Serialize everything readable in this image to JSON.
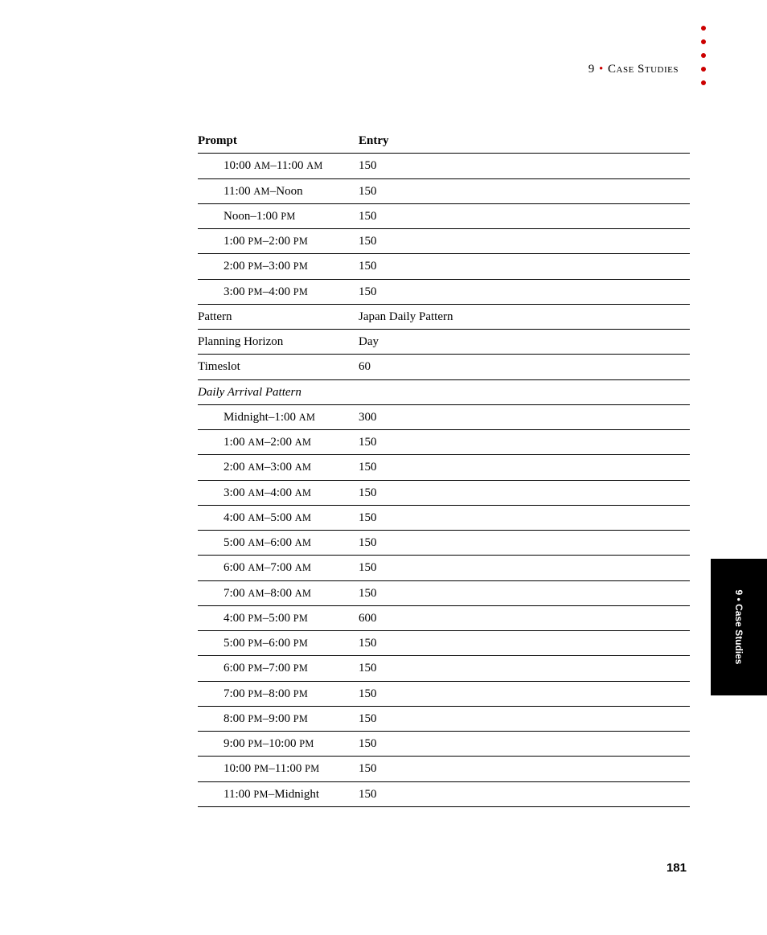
{
  "header": {
    "chapter_number": "9",
    "separator": "•",
    "chapter_title": "Case Studies"
  },
  "side_tab": "9 • Case Studies",
  "page_number": "181",
  "table": {
    "col1_header": "Prompt",
    "col2_header": "Entry",
    "rows": [
      {
        "type": "indent-time",
        "prefix": "10:00",
        "ampm1": "am",
        "dash": "–",
        "suffix": "11:00",
        "ampm2": "am",
        "entry": "150"
      },
      {
        "type": "indent-time",
        "prefix": "11:00",
        "ampm1": "am",
        "dash": "–",
        "suffix": "Noon",
        "ampm2": "",
        "entry": "150"
      },
      {
        "type": "indent-time",
        "prefix": "Noon",
        "ampm1": "",
        "dash": "–",
        "suffix": "1:00",
        "ampm2": "pm",
        "entry": "150"
      },
      {
        "type": "indent-time",
        "prefix": "1:00",
        "ampm1": "pm",
        "dash": "–",
        "suffix": "2:00",
        "ampm2": "pm",
        "entry": "150"
      },
      {
        "type": "indent-time",
        "prefix": "2:00",
        "ampm1": "pm",
        "dash": "–",
        "suffix": "3:00",
        "ampm2": "pm",
        "entry": "150"
      },
      {
        "type": "indent-time",
        "prefix": "3:00",
        "ampm1": "pm",
        "dash": "–",
        "suffix": "4:00",
        "ampm2": "pm",
        "entry": "150"
      },
      {
        "type": "plain",
        "prompt": "Pattern",
        "entry": "Japan Daily Pattern"
      },
      {
        "type": "plain",
        "prompt": "Planning Horizon",
        "entry": "Day"
      },
      {
        "type": "plain",
        "prompt": "Timeslot",
        "entry": "60"
      },
      {
        "type": "section",
        "prompt": "Daily Arrival Pattern",
        "entry": ""
      },
      {
        "type": "indent-time",
        "prefix": "Midnight",
        "ampm1": "",
        "dash": "–",
        "suffix": "1:00",
        "ampm2": "am",
        "entry": "300"
      },
      {
        "type": "indent-time",
        "prefix": "1:00",
        "ampm1": "am",
        "dash": "–",
        "suffix": "2:00",
        "ampm2": "am",
        "entry": "150"
      },
      {
        "type": "indent-time",
        "prefix": "2:00",
        "ampm1": "am",
        "dash": "–",
        "suffix": "3:00",
        "ampm2": "am",
        "entry": "150"
      },
      {
        "type": "indent-time",
        "prefix": "3:00",
        "ampm1": "am",
        "dash": "–",
        "suffix": "4:00",
        "ampm2": "am",
        "entry": "150"
      },
      {
        "type": "indent-time",
        "prefix": "4:00",
        "ampm1": "am",
        "dash": "–",
        "suffix": "5:00",
        "ampm2": "am",
        "entry": "150"
      },
      {
        "type": "indent-time",
        "prefix": "5:00",
        "ampm1": "am",
        "dash": "–",
        "suffix": "6:00",
        "ampm2": "am",
        "entry": "150"
      },
      {
        "type": "indent-time",
        "prefix": "6:00",
        "ampm1": "am",
        "dash": "–",
        "suffix": "7:00",
        "ampm2": "am",
        "entry": "150"
      },
      {
        "type": "indent-time",
        "prefix": "7:00",
        "ampm1": "am",
        "dash": "–",
        "suffix": "8:00",
        "ampm2": "am",
        "entry": "150"
      },
      {
        "type": "indent-time",
        "prefix": "4:00",
        "ampm1": "pm",
        "dash": "–",
        "suffix": "5:00",
        "ampm2": "pm",
        "entry": "600"
      },
      {
        "type": "indent-time",
        "prefix": "5:00",
        "ampm1": "pm",
        "dash": "–",
        "suffix": "6:00",
        "ampm2": "pm",
        "entry": "150"
      },
      {
        "type": "indent-time",
        "prefix": "6:00",
        "ampm1": "pm",
        "dash": "–",
        "suffix": "7:00",
        "ampm2": "pm",
        "entry": "150"
      },
      {
        "type": "indent-time",
        "prefix": "7:00",
        "ampm1": "pm",
        "dash": "–",
        "suffix": "8:00",
        "ampm2": "pm",
        "entry": "150"
      },
      {
        "type": "indent-time",
        "prefix": "8:00",
        "ampm1": "pm",
        "dash": "–",
        "suffix": "9:00",
        "ampm2": "pm",
        "entry": "150"
      },
      {
        "type": "indent-time",
        "prefix": "9:00",
        "ampm1": "pm",
        "dash": "–",
        "suffix": "10:00",
        "ampm2": "pm",
        "entry": "150"
      },
      {
        "type": "indent-time",
        "prefix": "10:00",
        "ampm1": "pm",
        "dash": "–",
        "suffix": "11:00",
        "ampm2": "pm",
        "entry": "150"
      },
      {
        "type": "indent-time",
        "prefix": "11:00",
        "ampm1": "pm",
        "dash": "–",
        "suffix": "Midnight",
        "ampm2": "",
        "entry": "150"
      }
    ]
  }
}
